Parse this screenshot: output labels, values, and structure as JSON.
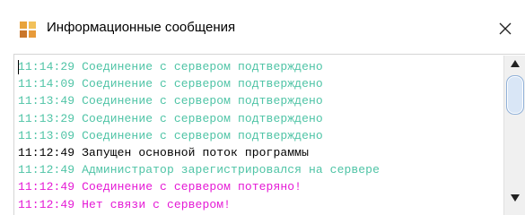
{
  "window": {
    "title": "Информационные сообщения"
  },
  "colors": {
    "ok": "#4fc4a6",
    "normal": "#000000",
    "error": "#e51ad5"
  },
  "log": [
    {
      "time": "11:14:29",
      "text": "Соединение с сервером подтверждено",
      "level": "ok"
    },
    {
      "time": "11:14:09",
      "text": "Соединение с сервером подтверждено",
      "level": "ok"
    },
    {
      "time": "11:13:49",
      "text": "Соединение с сервером подтверждено",
      "level": "ok"
    },
    {
      "time": "11:13:29",
      "text": "Соединение с сервером подтверждено",
      "level": "ok"
    },
    {
      "time": "11:13:09",
      "text": "Соединение с сервером подтверждено",
      "level": "ok"
    },
    {
      "time": "11:12:49",
      "text": "Запущен основной поток программы",
      "level": "normal"
    },
    {
      "time": "11:12:49",
      "text": "Администратор зарегистрировался на сервере",
      "level": "ok"
    },
    {
      "time": "11:12:49",
      "text": "Соединение с сервером потеряно!",
      "level": "error"
    },
    {
      "time": "11:12:49",
      "text": "Нет связи с сервером!",
      "level": "error"
    }
  ]
}
